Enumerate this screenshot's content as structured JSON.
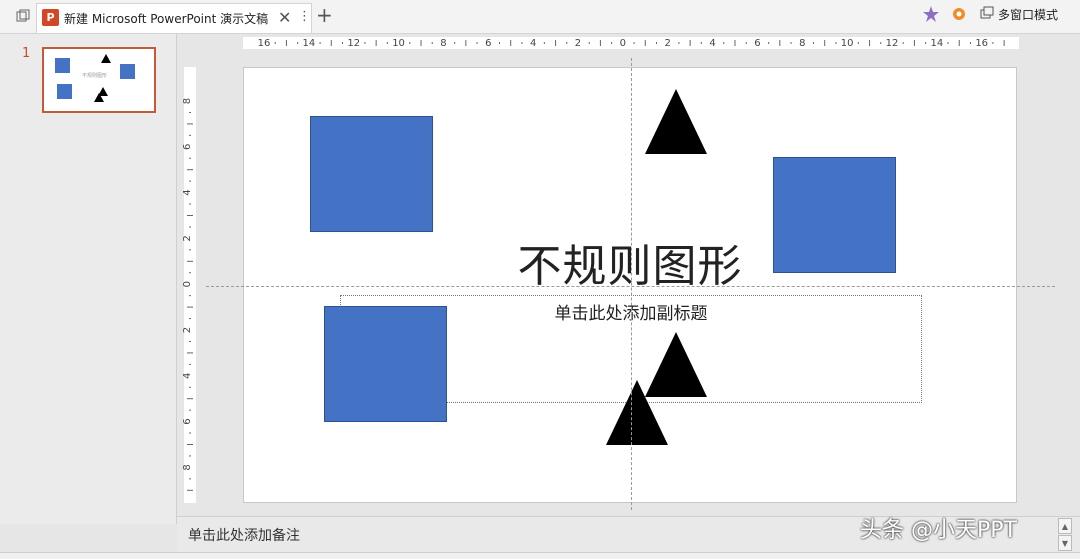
{
  "tabbar": {
    "doc_title": "新建 Microsoft PowerPoint 演示文稿",
    "logo_letter": "P",
    "close_glyph": "✕",
    "more_glyph": "⋮",
    "add_glyph": "+",
    "multi_window_label": "多窗口模式",
    "icons": [
      "window-restore-icon",
      "powerpoint-logo-icon",
      "close-icon",
      "more-icon",
      "add-tab-icon",
      "magic-wand-icon",
      "gear-icon",
      "multi-window-icon"
    ]
  },
  "sidebar": {
    "slides": [
      {
        "number": "1",
        "thumb_title": "不规则图形"
      }
    ]
  },
  "ruler": {
    "h_labels": [
      "16",
      "14",
      "12",
      "10",
      "8",
      "6",
      "4",
      "2",
      "0",
      "2",
      "4",
      "6",
      "8",
      "10",
      "12",
      "14",
      "16"
    ],
    "v_labels": [
      "8",
      "6",
      "4",
      "2",
      "0",
      "2",
      "4",
      "6",
      "8"
    ]
  },
  "slide": {
    "title": "不规则图形",
    "subtitle_placeholder": "单击此处添加副标题",
    "shape_fill": "#4472c4",
    "triangle_fill": "#000000"
  },
  "notes": {
    "placeholder": "单击此处添加备注"
  },
  "watermark": "头条 @小天PPT",
  "colors": {
    "accent": "#d24726",
    "selection_border": "#c55a3a"
  }
}
